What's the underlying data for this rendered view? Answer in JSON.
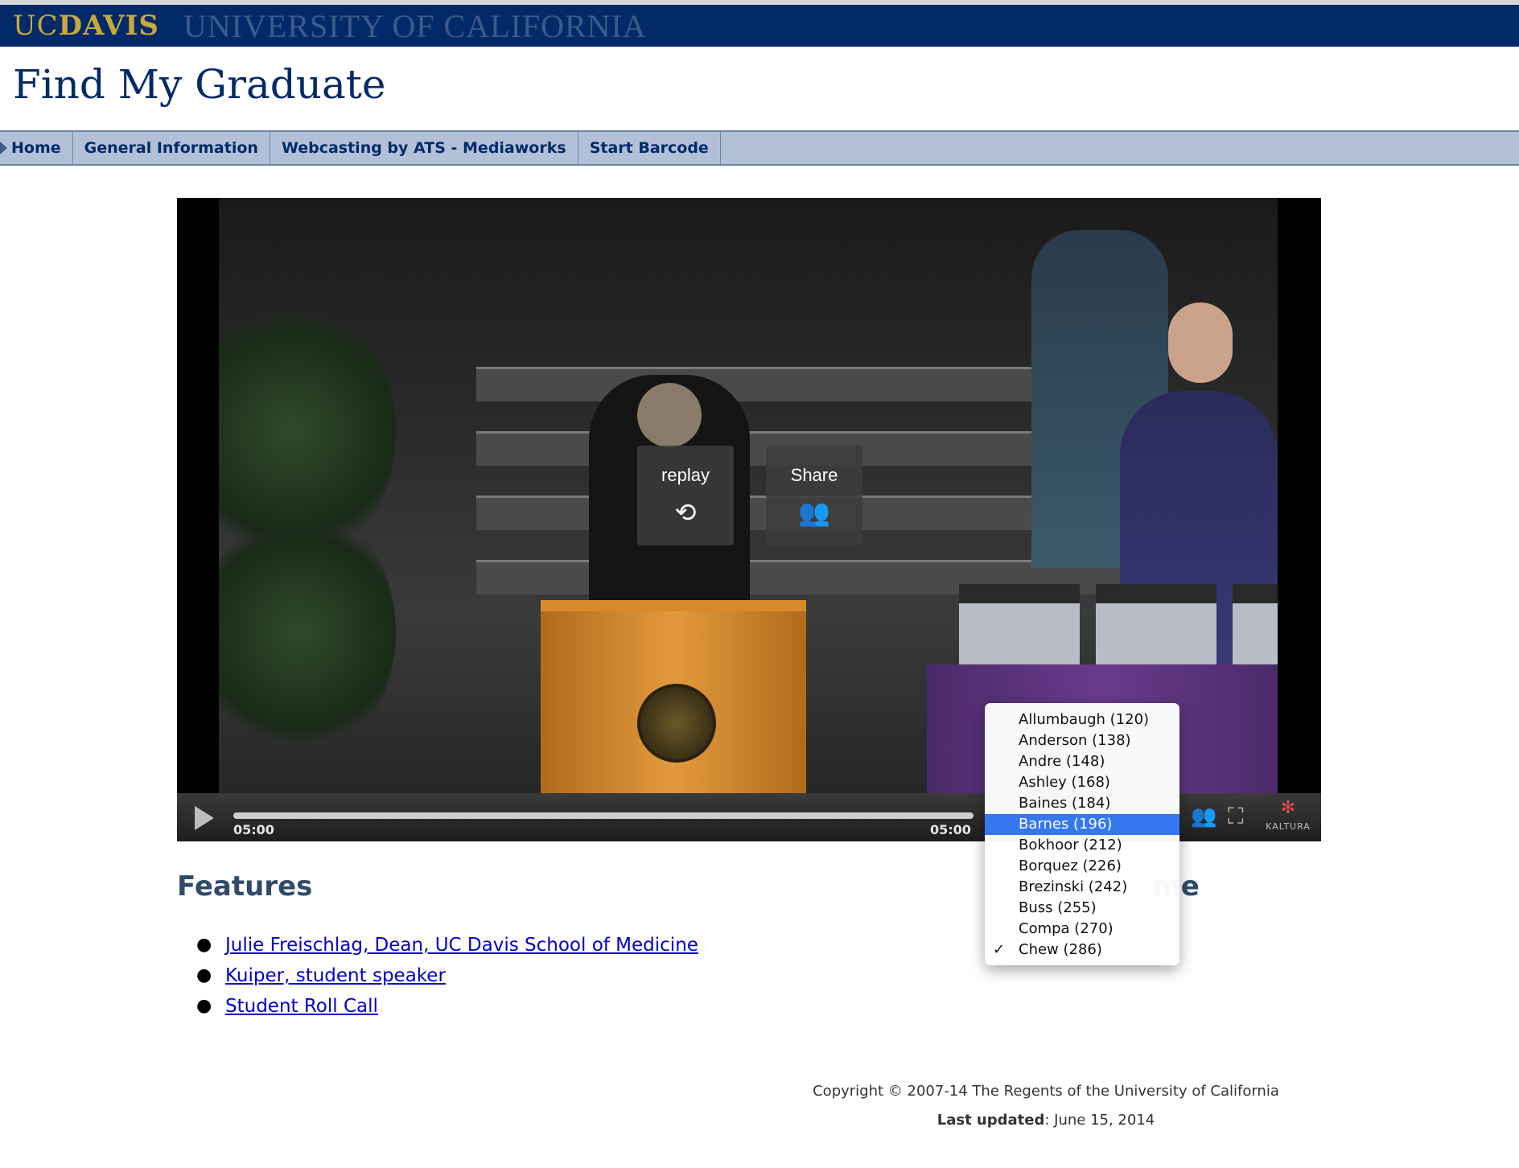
{
  "banner": {
    "logo_uc": "UC",
    "logo_davis": "DAVIS",
    "university": "UNIVERSITY OF CALIFORNIA"
  },
  "page": {
    "title": "Find My Graduate"
  },
  "nav": {
    "items": [
      {
        "label": "Home"
      },
      {
        "label": "General Information"
      },
      {
        "label": "Webcasting by ATS - Mediaworks"
      },
      {
        "label": "Start Barcode"
      }
    ]
  },
  "player": {
    "replay_label": "replay",
    "share_label": "Share",
    "current_time": "05:00",
    "duration": "05:00",
    "progress": 1.0,
    "brand": "KALTURA"
  },
  "features": {
    "heading": "Features",
    "links": [
      "Julie Freischlag, Dean, UC Davis School of Medicine",
      "Kuiper, student speaker",
      "Student Roll Call"
    ]
  },
  "family_name": {
    "heading_partial": "me"
  },
  "dropdown": {
    "options": [
      "Allumbaugh (120)",
      "Anderson (138)",
      "Andre (148)",
      "Ashley (168)",
      "Baines (184)",
      "Barnes (196)",
      "Bokhoor (212)",
      "Borquez (226)",
      "Brezinski (242)",
      "Buss (255)",
      "Compa (270)",
      "Chew (286)"
    ],
    "highlighted": "Barnes (196)",
    "checked": "Chew (286)",
    "check_mark": "✓"
  },
  "footer": {
    "copyright": "Copyright © 2007-14 The Regents of the University of California",
    "last_updated_label": "Last updated",
    "last_updated_value": ": June 15, 2014"
  },
  "colors": {
    "banner": "#022a68",
    "logo_gold": "#c9a93b",
    "nav_bg": "#b3c1d8",
    "highlight": "#3477f0"
  }
}
